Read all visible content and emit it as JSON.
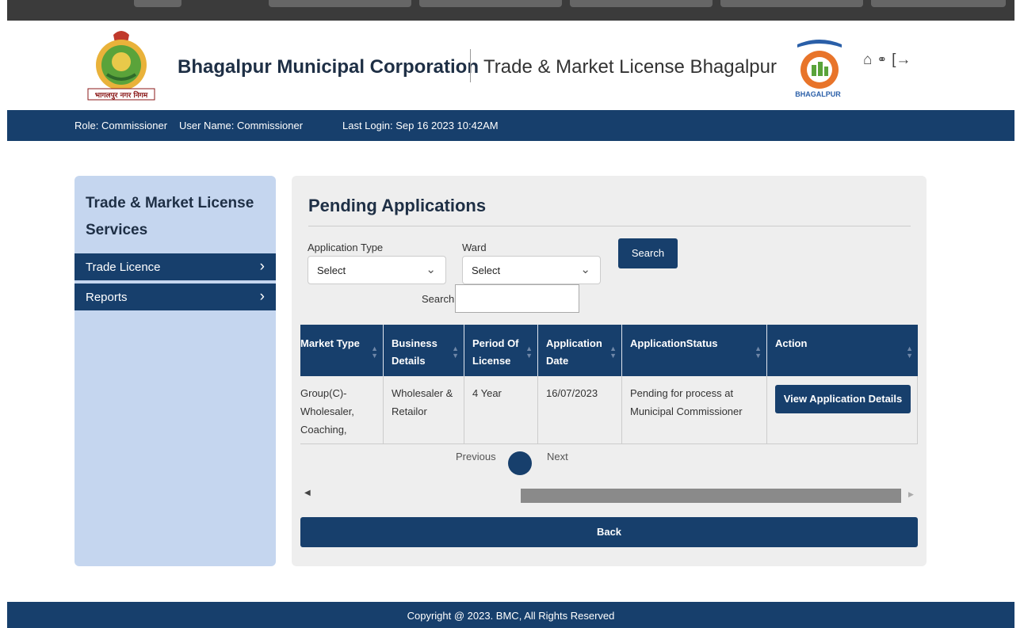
{
  "header": {
    "org_title": "Bhagalpur Municipal Corporation",
    "app_title": "Trade & Market License Bhagalpur",
    "logo_left_caption": "भागलपुर नगर निगम",
    "logo_right_caption": "BHAGALPUR",
    "icons": [
      "home-icon",
      "lock-icon",
      "logout-icon"
    ]
  },
  "userbar": {
    "role": "Role: Commissioner",
    "user_name": "User Name: Commissioner",
    "last_login": "Last Login: Sep 16 2023 10:42AM"
  },
  "sidebar": {
    "title": "Trade & Market License Services",
    "items": [
      {
        "label": "Trade Licence"
      },
      {
        "label": "Reports"
      }
    ]
  },
  "panel": {
    "title": "Pending Applications",
    "filters": {
      "application_type_label": "Application Type",
      "application_type_value": "Select",
      "ward_label": "Ward",
      "ward_value": "Select",
      "search_button": "Search",
      "search_label": "Search:",
      "search_value": ""
    },
    "table": {
      "columns": [
        "Market Type",
        "Business Details",
        "Period Of License",
        "Application Date",
        "ApplicationStatus",
        "Action"
      ],
      "rows": [
        {
          "market_type": "Group(C)-Wholesaler, Coaching,",
          "business_details": "Wholesaler & Retailor",
          "period": "4 Year",
          "application_date": "16/07/2023",
          "status": "Pending for process at Municipal Commissioner",
          "action": "View Application Details"
        }
      ]
    },
    "pager": {
      "previous": "Previous",
      "next": "Next"
    },
    "back_button": "Back"
  },
  "footer": {
    "copyright": "Copyright @ 2023. BMC, All Rights Reserved"
  },
  "colors": {
    "primary": "#173f6c",
    "sidebar_bg": "#c5d6ef",
    "panel_bg": "#eeeeee"
  }
}
